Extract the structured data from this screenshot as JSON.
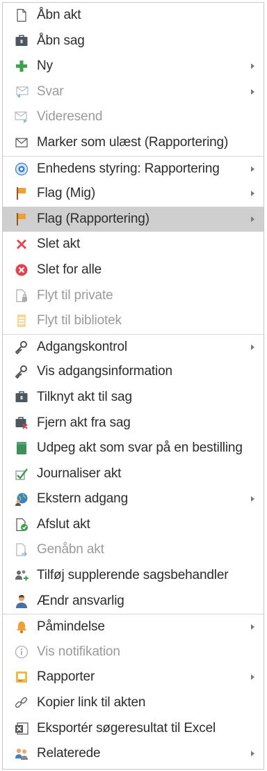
{
  "menu": {
    "items": [
      {
        "label": "Åbn akt",
        "icon": "document-icon"
      },
      {
        "label": "Åbn sag",
        "icon": "case-icon"
      },
      {
        "label": "Ny",
        "icon": "plus-icon"
      },
      {
        "label": "Svar",
        "icon": "reply-mail-icon"
      },
      {
        "label": "Videresend",
        "icon": "forward-mail-icon"
      },
      {
        "label": "Marker som ulæst (Rapportering)",
        "icon": "envelope-icon"
      },
      {
        "label": "Enhedens styring: Rapportering",
        "icon": "eye-icon"
      },
      {
        "label": "Flag (Mig)",
        "icon": "flag-icon"
      },
      {
        "label": "Flag (Rapportering)",
        "icon": "flag-icon"
      },
      {
        "label": "Slet akt",
        "icon": "red-x-icon"
      },
      {
        "label": "Slet for alle",
        "icon": "delete-circle-icon"
      },
      {
        "label": "Flyt til private",
        "icon": "lock-document-icon"
      },
      {
        "label": "Flyt til bibliotek",
        "icon": "library-icon"
      },
      {
        "label": "Adgangskontrol",
        "icon": "key-icon"
      },
      {
        "label": "Vis adgangsinformation",
        "icon": "key-icon"
      },
      {
        "label": "Tilknyt akt til sag",
        "icon": "case-icon"
      },
      {
        "label": "Fjern akt fra sag",
        "icon": "case-remove-icon"
      },
      {
        "label": "Udpeg akt som svar på en bestilling",
        "icon": "green-document-icon"
      },
      {
        "label": "Journaliser akt",
        "icon": "checkmark-icon"
      },
      {
        "label": "Ekstern adgang",
        "icon": "globe-user-icon"
      },
      {
        "label": "Afslut akt",
        "icon": "document-check-icon"
      },
      {
        "label": "Genåbn akt",
        "icon": "document-reopen-icon"
      },
      {
        "label": "Tilføj supplerende sagsbehandler",
        "icon": "add-users-icon"
      },
      {
        "label": "Ændr ansvarlig",
        "icon": "user-icon"
      },
      {
        "label": "Påmindelse",
        "icon": "bell-icon"
      },
      {
        "label": "Vis notifikation",
        "icon": "info-icon"
      },
      {
        "label": "Rapporter",
        "icon": "report-icon"
      },
      {
        "label": "Kopier link til akten",
        "icon": "link-icon"
      },
      {
        "label": "Eksportér søgeresultat til Excel",
        "icon": "excel-icon"
      },
      {
        "label": "Relaterede",
        "icon": "users-icon"
      }
    ]
  }
}
